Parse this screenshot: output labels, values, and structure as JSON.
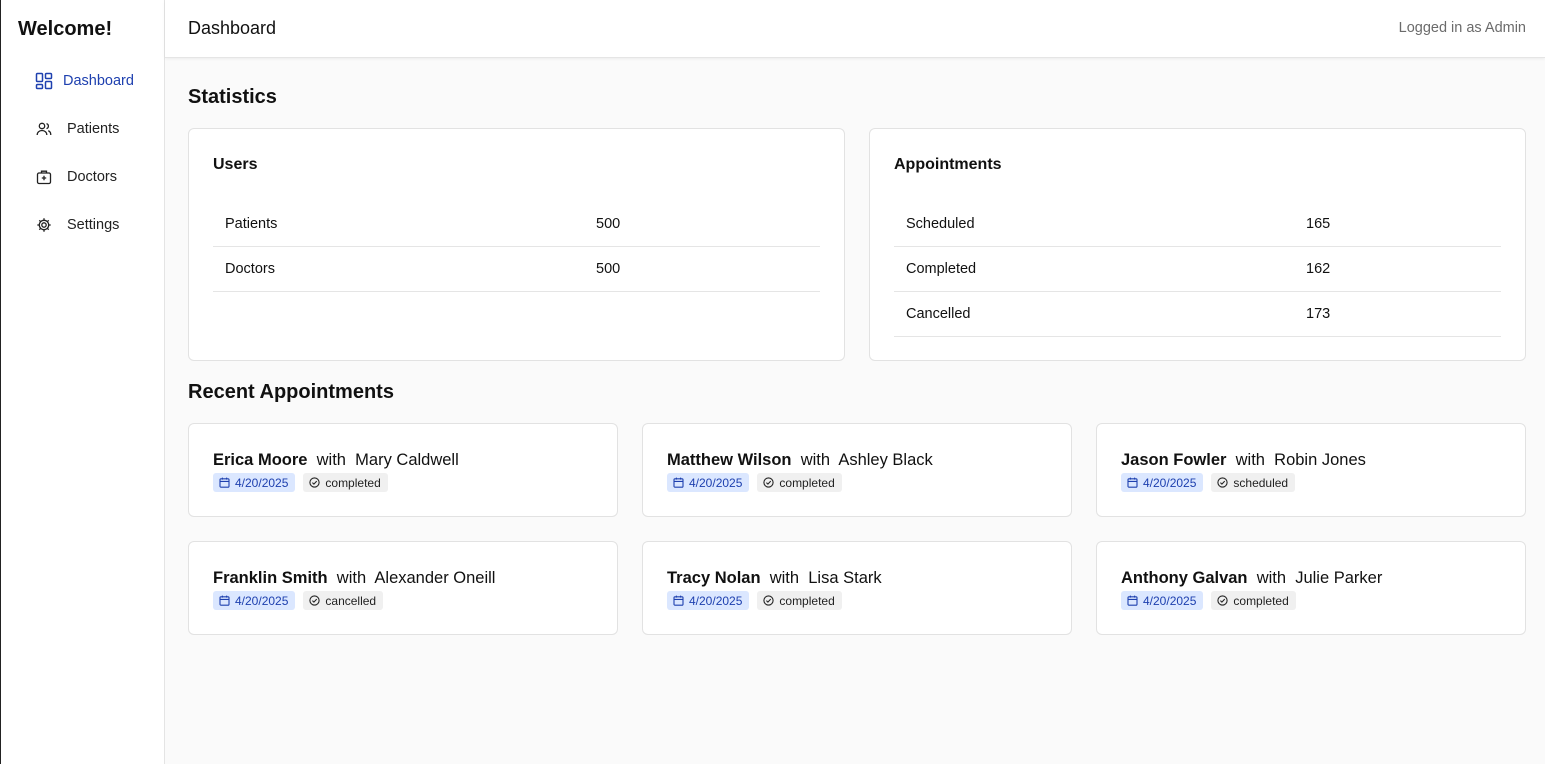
{
  "sidebar": {
    "brand": "Welcome!",
    "items": [
      {
        "label": "Dashboard",
        "icon": "dashboard-icon",
        "active": true
      },
      {
        "label": "Patients",
        "icon": "users-icon"
      },
      {
        "label": "Doctors",
        "icon": "briefcase-medical-icon"
      },
      {
        "label": "Settings",
        "icon": "gear-icon"
      }
    ]
  },
  "header": {
    "title": "Dashboard",
    "user": "Logged in as Admin"
  },
  "statistics": {
    "title": "Statistics",
    "users": {
      "title": "Users",
      "rows": [
        {
          "label": "Patients",
          "value": "500"
        },
        {
          "label": "Doctors",
          "value": "500"
        }
      ]
    },
    "appointments": {
      "title": "Appointments",
      "rows": [
        {
          "label": "Scheduled",
          "value": "165"
        },
        {
          "label": "Completed",
          "value": "162"
        },
        {
          "label": "Cancelled",
          "value": "173"
        }
      ]
    }
  },
  "recent": {
    "title": "Recent Appointments",
    "connector": "with",
    "items": [
      {
        "patient": "Erica Moore",
        "doctor": "Mary Caldwell",
        "date": "4/20/2025",
        "status": "completed"
      },
      {
        "patient": "Matthew Wilson",
        "doctor": "Ashley Black",
        "date": "4/20/2025",
        "status": "completed"
      },
      {
        "patient": "Jason Fowler",
        "doctor": "Robin Jones",
        "date": "4/20/2025",
        "status": "scheduled"
      },
      {
        "patient": "Franklin Smith",
        "doctor": "Alexander Oneill",
        "date": "4/20/2025",
        "status": "cancelled"
      },
      {
        "patient": "Tracy Nolan",
        "doctor": "Lisa Stark",
        "date": "4/20/2025",
        "status": "completed"
      },
      {
        "patient": "Anthony Galvan",
        "doctor": "Julie Parker",
        "date": "4/20/2025",
        "status": "completed"
      }
    ]
  },
  "colors": {
    "accent": "#1e40af",
    "date_badge_bg": "#dbe7ff",
    "status_badge_bg": "#f0f0f0"
  }
}
